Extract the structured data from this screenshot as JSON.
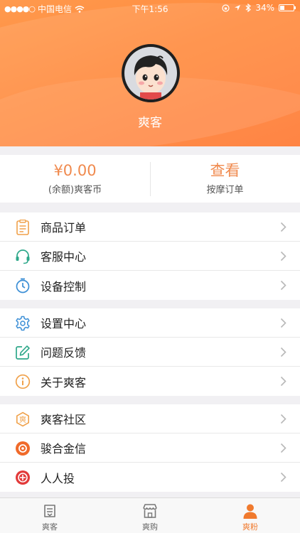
{
  "status_bar": {
    "carrier": "中国电信",
    "time": "下午1:56",
    "battery": "34%",
    "battery_level": 0.34
  },
  "profile": {
    "username": "爽客"
  },
  "stats": {
    "balance_value": "¥0.00",
    "balance_label": "(余额)爽客币",
    "orders_value": "查看",
    "orders_label": "按摩订单"
  },
  "menu_groups": [
    [
      {
        "label": "商品订单",
        "icon": "order-list-icon",
        "color": "#f0a14a"
      },
      {
        "label": "客服中心",
        "icon": "headset-icon",
        "color": "#2ea88a"
      },
      {
        "label": "设备控制",
        "icon": "timer-icon",
        "color": "#3c8fd6"
      }
    ],
    [
      {
        "label": "设置中心",
        "icon": "gear-icon",
        "color": "#3c8fd6"
      },
      {
        "label": "问题反馈",
        "icon": "edit-icon",
        "color": "#2ea88a"
      },
      {
        "label": "关于爽客",
        "icon": "info-icon",
        "color": "#f0a14a"
      }
    ],
    [
      {
        "label": "爽客社区",
        "icon": "community-icon",
        "color": "#f0a14a"
      },
      {
        "label": "骏合金信",
        "icon": "junhe-logo-icon",
        "color": "#f06a2a"
      },
      {
        "label": "人人投",
        "icon": "renrentou-logo-icon",
        "color": "#e23a3a"
      }
    ]
  ],
  "tabs": [
    {
      "label": "爽客",
      "icon": "shuangke-tab-icon"
    },
    {
      "label": "爽购",
      "icon": "shop-tab-icon"
    },
    {
      "label": "爽粉",
      "icon": "person-tab-icon",
      "active": true
    }
  ],
  "colors": {
    "accent": "#f07a2e",
    "header_orange": "#ff8a3d"
  }
}
